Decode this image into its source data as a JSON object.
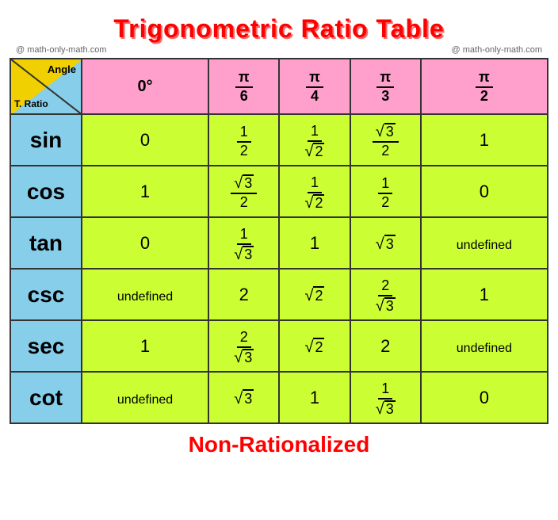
{
  "title": "Trigonometric Ratio Table",
  "watermark": "@ math-only-math.com",
  "subtitle": "Non-Rationalized",
  "header": {
    "angle_label": "Angle",
    "ratio_label": "T. Ratio",
    "columns": [
      "0°",
      "π/6",
      "π/4",
      "π/3",
      "π/2"
    ]
  },
  "rows": [
    {
      "label": "sin",
      "values": [
        "0",
        "1/2",
        "1/√2",
        "√3/2",
        "1"
      ]
    },
    {
      "label": "cos",
      "values": [
        "1",
        "√3/2",
        "1/√2",
        "1/2",
        "0"
      ]
    },
    {
      "label": "tan",
      "values": [
        "0",
        "1/√3",
        "1",
        "√3",
        "undefined"
      ]
    },
    {
      "label": "csc",
      "values": [
        "undefined",
        "2",
        "√2",
        "2/√3",
        "1"
      ]
    },
    {
      "label": "sec",
      "values": [
        "1",
        "2/√3",
        "√2",
        "2",
        "undefined"
      ]
    },
    {
      "label": "cot",
      "values": [
        "undefined",
        "√3",
        "1",
        "1/√3",
        "0"
      ]
    }
  ]
}
